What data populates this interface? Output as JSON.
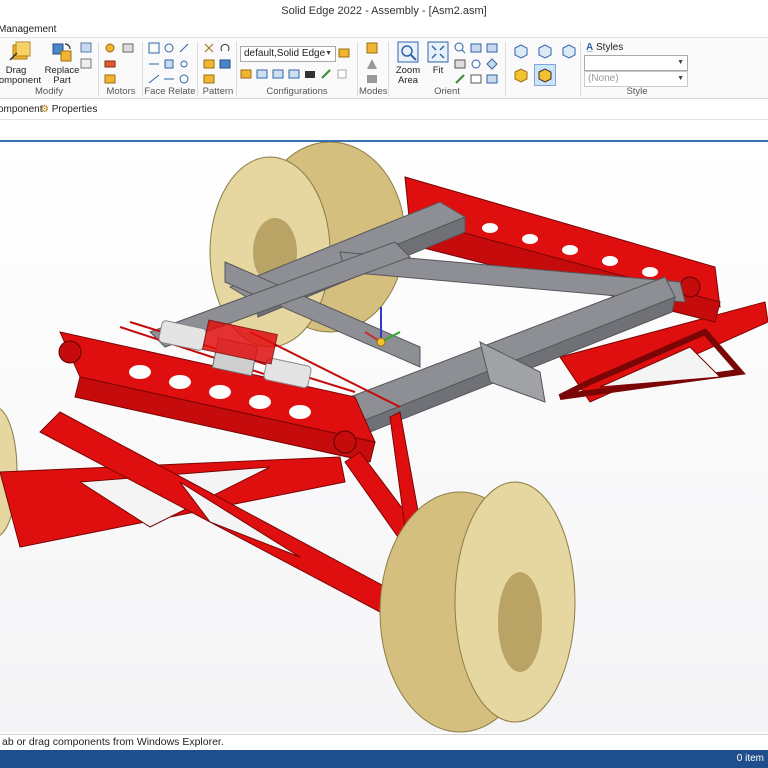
{
  "window": {
    "title": "Solid Edge 2022 - Assembly - [Asm2.asm]"
  },
  "ribbon_tab": {
    "label": "Management"
  },
  "ribbon": {
    "modify": {
      "label": "Modify",
      "drag_component": "Drag\nComponent",
      "replace_part": "Replace\nPart"
    },
    "motors": {
      "label": "Motors"
    },
    "face_relate": {
      "label": "Face Relate"
    },
    "pattern": {
      "label": "Pattern"
    },
    "configurations": {
      "label": "Configurations",
      "combo_value": "default,Solid Edge"
    },
    "modes": {
      "label": "Modes"
    },
    "orient": {
      "label": "Orient",
      "zoom_area": "Zoom\nArea",
      "fit": "Fit"
    },
    "style": {
      "label": "Style",
      "styles_label": "Styles",
      "style_combo_value": "",
      "none_combo_value": "(None)"
    }
  },
  "pathfinder": {
    "component_tab": "omponent",
    "properties_tab": "Properties"
  },
  "status": {
    "message": "ab or drag components from Windows Explorer.",
    "count": "0 item"
  },
  "colors": {
    "frame_red": "#e00f0f",
    "crossmember_gray": "#8d8f94",
    "tire_tan": "#d8c68a",
    "accent_blue": "#1f4e8c"
  },
  "icons": [
    "drag-component-icon",
    "replace-part-icon",
    "zoom-area-icon",
    "fit-icon",
    "styles-icon",
    "properties-icon",
    "triad-icon"
  ]
}
